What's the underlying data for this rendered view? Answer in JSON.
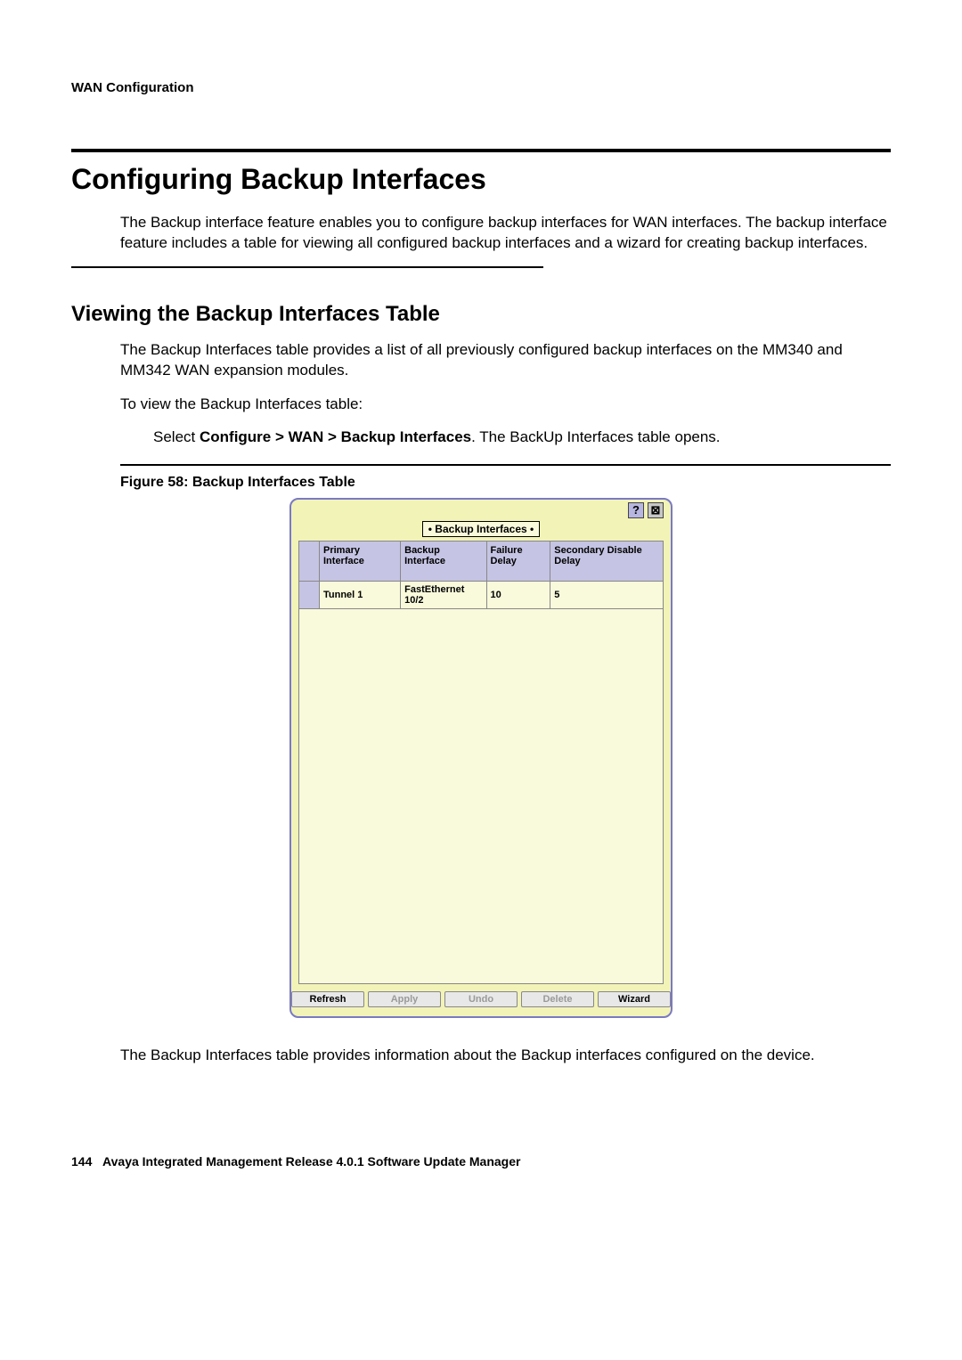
{
  "header": {
    "breadcrumb": "WAN Configuration"
  },
  "h1": "Configuring Backup Interfaces",
  "intro": "The Backup interface feature enables you to configure backup interfaces for WAN interfaces. The backup interface feature includes a table for viewing all configured backup interfaces and a wizard for creating backup interfaces.",
  "h2": "Viewing the Backup Interfaces Table",
  "p1": "The Backup Interfaces table provides a list of all previously configured backup interfaces on the MM340 and MM342 WAN expansion modules.",
  "p2": "To view the Backup Interfaces table:",
  "step_pre": "Select ",
  "step_bold": "Configure > WAN > Backup Interfaces",
  "step_post": ". The BackUp Interfaces table opens.",
  "fig_caption": "Figure 58: Backup Interfaces Table",
  "app": {
    "title": "• Backup Interfaces •",
    "help_glyph": "?",
    "close_glyph": "⊠",
    "columns": {
      "c1": "Primary Interface",
      "c2": "Backup Interface",
      "c3": "Failure Delay",
      "c4": "Secondary Disable Delay"
    },
    "row": {
      "c1": "Tunnel 1",
      "c2": "FastEthernet 10/2",
      "c3": "10",
      "c4": "5"
    },
    "buttons": {
      "refresh": "Refresh",
      "apply": "Apply",
      "undo": "Undo",
      "delete": "Delete",
      "wizard": "Wizard"
    }
  },
  "closing": "The Backup Interfaces table provides information about the Backup interfaces configured on the device.",
  "footer": {
    "page": "144",
    "title": "Avaya Integrated Management Release 4.0.1 Software Update Manager"
  }
}
